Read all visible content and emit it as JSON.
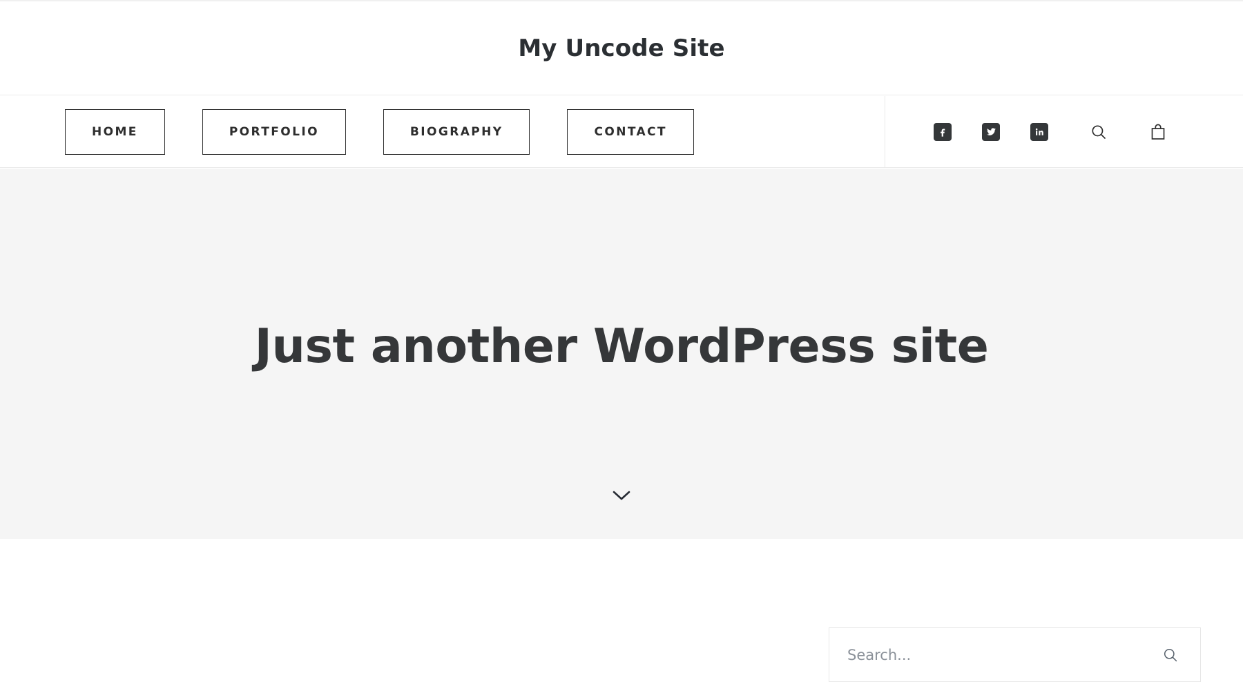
{
  "header": {
    "site_title": "My Uncode Site"
  },
  "nav": {
    "items": [
      {
        "label": "Home",
        "name": "nav-item-home"
      },
      {
        "label": "Portfolio",
        "name": "nav-item-portfolio"
      },
      {
        "label": "Biography",
        "name": "nav-item-biography"
      },
      {
        "label": "Contact",
        "name": "nav-item-contact"
      }
    ],
    "social": [
      {
        "icon": "facebook-icon",
        "label": "Facebook"
      },
      {
        "icon": "twitter-icon",
        "label": "Twitter"
      },
      {
        "icon": "linkedin-icon",
        "label": "LinkedIn"
      }
    ],
    "utilities": [
      {
        "icon": "search-icon",
        "label": "Search"
      },
      {
        "icon": "shopping-bag-icon",
        "label": "Cart"
      }
    ]
  },
  "hero": {
    "heading": "Just another WordPress site",
    "scroll_icon": "chevron-down-icon",
    "background_color": "#f5f5f5"
  },
  "search": {
    "placeholder": "Search...",
    "value": "",
    "submit_icon": "search-icon"
  },
  "colors": {
    "text_dark": "#2e2e2e",
    "heading": "#353739",
    "social_badge": "#343739",
    "border_light": "#e9e9e9",
    "page_background": "#ffffff"
  }
}
